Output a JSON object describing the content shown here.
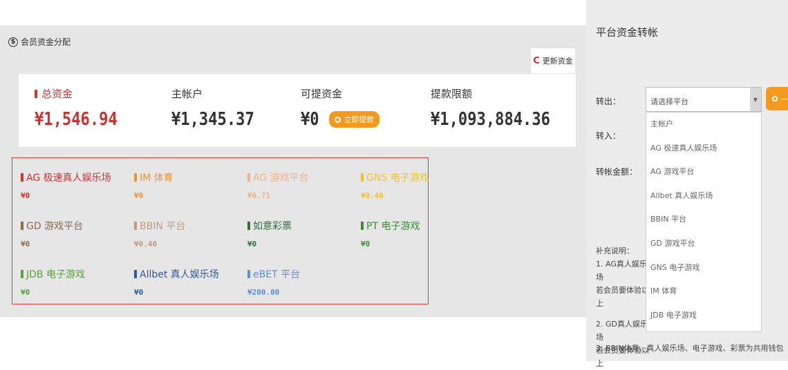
{
  "section": {
    "title": "会员资金分配",
    "icon": "dollar-circle-icon"
  },
  "refresh": {
    "label": "更新资金",
    "icon": "refresh-icon"
  },
  "summary": {
    "total": {
      "label": "总资金",
      "value": "¥1,546.94"
    },
    "main": {
      "label": "主帐户",
      "value": "¥1,345.37"
    },
    "withdrawable": {
      "label": "可提资金",
      "value": "¥0",
      "button": "立即提款"
    },
    "limit": {
      "label": "提款限额",
      "value": "¥1,093,884.36"
    }
  },
  "platforms": [
    {
      "name": "AG 极速真人娱乐场",
      "value": "¥0",
      "color": "#d9302c"
    },
    {
      "name": "IM 体育",
      "value": "¥0",
      "color": "#f0913a"
    },
    {
      "name": "AG 游戏平台",
      "value": "¥0.71",
      "color": "#f4b183"
    },
    {
      "name": "GNS 电子游戏",
      "value": "¥0.46",
      "color": "#f2c12e"
    },
    {
      "name": "GD 游戏平台",
      "value": "¥0",
      "color": "#8b6a4f"
    },
    {
      "name": "BBIN 平台",
      "value": "¥0.40",
      "color": "#c49a7a"
    },
    {
      "name": "如意彩票",
      "value": "¥0",
      "color": "#2e6e3e"
    },
    {
      "name": "PT 电子游戏",
      "value": "¥0",
      "color": "#3d8a3d"
    },
    {
      "name": "JDB 电子游戏",
      "value": "¥0",
      "color": "#5aa03c"
    },
    {
      "name": "Allbet 真人娱乐场",
      "value": "¥0",
      "color": "#2d5aa8"
    },
    {
      "name": "eBET 平台",
      "value": "¥200.00",
      "color": "#5b8fd6"
    }
  ],
  "transfer": {
    "title": "平台资金转帐",
    "from_label": "转出：",
    "to_label": "转入：",
    "amount_label": "转帐金额：",
    "select_placeholder": "请选择平台",
    "go_label": "一",
    "options": [
      "主帐户",
      "AG 极速真人娱乐场",
      "AG 游戏平台",
      "Allbet 真人娱乐场",
      "BBIN 平台",
      "GD 游戏平台",
      "GNS 电子游戏",
      "IM 体育",
      "JDB 电子游戏"
    ],
    "notes_title": "补充说明：",
    "note1a": "1. AG真人娱乐场",
    "note1b": "若会员要体验以上",
    "note2a": "2. GD真人娱乐场",
    "note2b": "若会员要体验以上",
    "note3": "3. BBIN体育、真人娱乐场、电子游戏、彩票为共用钱包"
  }
}
